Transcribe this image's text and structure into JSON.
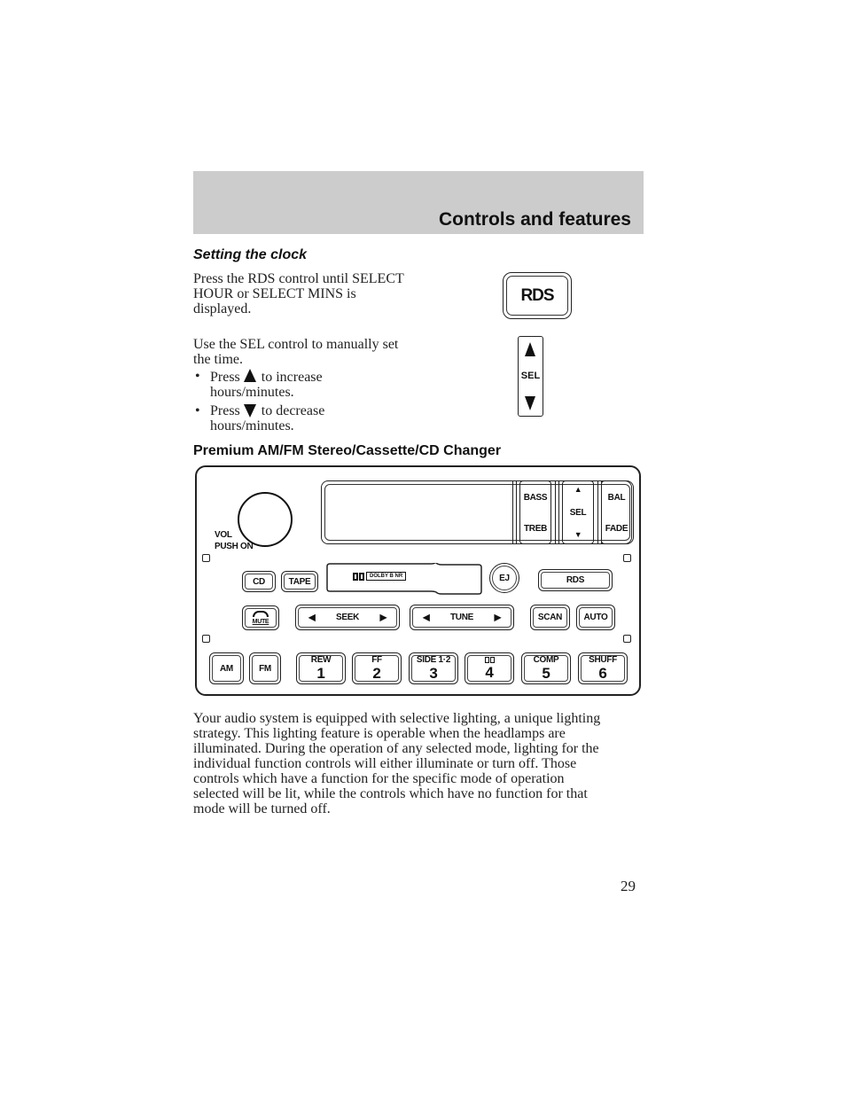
{
  "header": {
    "title": "Controls and features"
  },
  "clock_section": {
    "title": "Setting the clock",
    "para1": [
      "Press the RDS control until SELECT",
      "HOUR or SELECT MINS is",
      "displayed."
    ],
    "para2": [
      "Use the SEL control to manually set",
      "the time."
    ],
    "bullets": [
      {
        "prefix": "Press",
        "icon": "up-triangle-icon",
        "suffix": "to increase",
        "line2": "hours/minutes."
      },
      {
        "prefix": "Press",
        "icon": "down-triangle-icon",
        "suffix": "to decrease",
        "line2": "hours/minutes."
      }
    ],
    "rds_figure_label": "RDS",
    "sel_figure_label": "SEL"
  },
  "radio_section": {
    "title": "Premium AM/FM Stereo/Cassette/CD Changer",
    "panel": {
      "vol_label": [
        "VOL",
        "PUSH ON"
      ],
      "bass": "BASS",
      "treb": "TREB",
      "sel": "SEL",
      "bal": "BAL",
      "fade": "FADE",
      "cd": "CD",
      "tape": "TAPE",
      "dolby_label": "DOLBY B NR",
      "ej": "EJ",
      "rds": "RDS",
      "mute": "MUTE",
      "seek": "SEEK",
      "tune": "TUNE",
      "scan": "SCAN",
      "auto": "AUTO",
      "am": "AM",
      "fm": "FM",
      "presets": [
        {
          "label": "REW",
          "num": "1"
        },
        {
          "label": "FF",
          "num": "2"
        },
        {
          "label": "SIDE 1·2",
          "num": "3"
        },
        {
          "label": "DD",
          "num": "4"
        },
        {
          "label": "COMP",
          "num": "5"
        },
        {
          "label": "SHUFF",
          "num": "6"
        }
      ]
    }
  },
  "body_text": [
    "Your audio system is equipped with selective lighting, a unique lighting",
    "strategy. This lighting feature is operable when the headlamps are",
    "illuminated. During the operation of any selected mode, lighting for the",
    "individual function controls will either illuminate or turn off. Those",
    "controls which have a function for the specific mode of operation",
    "selected will be lit, while the controls which have no function for that",
    "mode will be turned off."
  ],
  "page_number": "29"
}
